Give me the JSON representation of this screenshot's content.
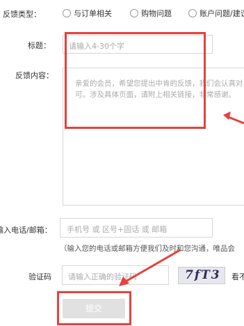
{
  "feedback_type": {
    "label": "反馈类型：",
    "options": [
      "与订单相关",
      "购物问题",
      "账户问题/建议"
    ]
  },
  "title_field": {
    "label": "标题：",
    "placeholder": "请输入4-30个字"
  },
  "content_field": {
    "label": "反馈内容：",
    "placeholder_line1": "亲爱的会员，希望您提出中肯的反馈，我们会认真对",
    "placeholder_line2": "可。涉及具体页面，请附上相关链接，非常感谢。"
  },
  "contact_field": {
    "label": "输入电话/邮箱：",
    "placeholder": "手机号 或 区号+固话 或 邮箱",
    "hint": "（输入您的电话或邮箱方便我们及时和您沟通，唯品会"
  },
  "captcha": {
    "label": "验证码",
    "placeholder": "请输入正确的验证码",
    "image_text": "7fT3",
    "refresh_text": "看不"
  },
  "submit": {
    "label": "提交"
  },
  "colors": {
    "annotation_red": "#e8403a",
    "disabled_button": "#e1e1e1"
  }
}
